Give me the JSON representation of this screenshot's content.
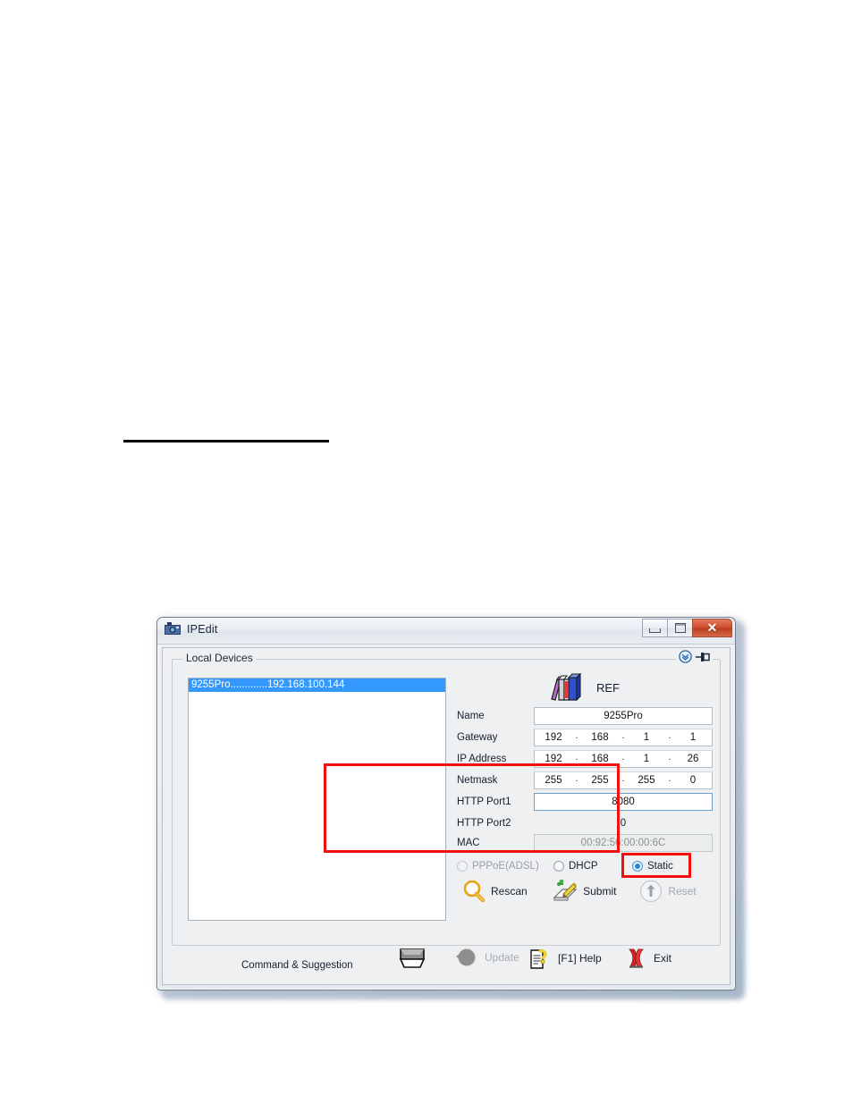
{
  "window": {
    "title": "IPEdit",
    "app_icon": "camera-icon",
    "buttons": {
      "minimize": "minimize-icon",
      "maximize": "maximize-icon",
      "close": "✕"
    }
  },
  "group": {
    "legend": "Local Devices",
    "tools": {
      "collapse": "chevron-down-circle-icon",
      "pin": "pushpin-icon"
    }
  },
  "device_list": {
    "items": [
      {
        "label": "9255Pro.............192.168.100.144",
        "selected": true
      }
    ]
  },
  "ref": {
    "icon": "reference-books-icon",
    "label": "REF"
  },
  "fields": [
    {
      "key": "name",
      "label": "Name",
      "type": "text",
      "value": "9255Pro",
      "state": "normal"
    },
    {
      "key": "gateway",
      "label": "Gateway",
      "type": "ip",
      "value": [
        "192",
        "168",
        "1",
        "1"
      ],
      "state": "normal"
    },
    {
      "key": "ip_address",
      "label": "IP Address",
      "type": "ip",
      "value": [
        "192",
        "168",
        "1",
        "26"
      ],
      "state": "normal"
    },
    {
      "key": "netmask",
      "label": "Netmask",
      "type": "ip",
      "value": [
        "255",
        "255",
        "255",
        "0"
      ],
      "state": "normal"
    },
    {
      "key": "http_port1",
      "label": "HTTP Port1",
      "type": "text",
      "value": "8080",
      "state": "focus"
    },
    {
      "key": "http_port2",
      "label": "HTTP Port2",
      "type": "text",
      "value": "0",
      "state": "flat-disabled"
    },
    {
      "key": "mac",
      "label": "MAC",
      "type": "text",
      "value": "00:92:56:00:00:6C",
      "state": "disabled"
    }
  ],
  "connection_mode": {
    "options": [
      {
        "id": "pppoe",
        "label": "PPPoE(ADSL)",
        "selected": false,
        "disabled": true
      },
      {
        "id": "dhcp",
        "label": "DHCP",
        "selected": false,
        "disabled": false
      },
      {
        "id": "static",
        "label": "Static",
        "selected": true,
        "disabled": false
      }
    ]
  },
  "actions": [
    {
      "id": "rescan",
      "label": "Rescan",
      "icon": "magnifier-icon",
      "disabled": false
    },
    {
      "id": "submit",
      "label": "Submit",
      "icon": "pencil-note-icon",
      "disabled": false
    },
    {
      "id": "reset",
      "label": "Reset",
      "icon": "arrow-up-circle-icon",
      "disabled": true
    }
  ],
  "bottom_bar": {
    "status_label": "Command & Suggestion",
    "box_icon": "tray-icon",
    "items": [
      {
        "id": "update",
        "label": "Update",
        "icon": "refresh-icon",
        "disabled": true
      },
      {
        "id": "help",
        "label": "[F1] Help",
        "icon": "help-document-icon",
        "disabled": false
      },
      {
        "id": "exit",
        "label": "Exit",
        "icon": "red-x-icon",
        "disabled": false
      }
    ]
  },
  "highlights": {
    "fields_box": "red-rectangle",
    "static_box": "red-rectangle"
  },
  "colors": {
    "selection": "#3399ff",
    "highlight": "#f60d0d",
    "close_button": "#cf4e2c"
  }
}
